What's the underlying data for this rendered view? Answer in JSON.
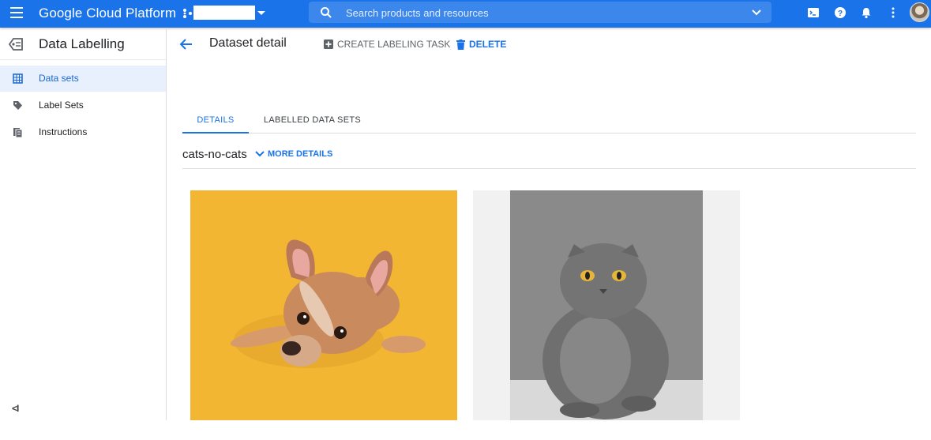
{
  "topbar": {
    "brand": "Google Cloud Platform",
    "search_placeholder": "Search products and resources",
    "icons": [
      "menu-icon",
      "project-icon",
      "search-icon",
      "chevron-down-icon",
      "cloud-shell-icon",
      "help-icon",
      "notifications-icon",
      "more-vert-icon"
    ],
    "accent": "#1a73e8"
  },
  "sidebar": {
    "title": "Data Labelling",
    "items": [
      {
        "label": "Data sets",
        "icon": "dataset-icon",
        "active": true
      },
      {
        "label": "Label Sets",
        "icon": "label-icon",
        "active": false
      },
      {
        "label": "Instructions",
        "icon": "instructions-icon",
        "active": false
      }
    ],
    "collapse_label": "<I"
  },
  "main": {
    "title": "Dataset detail",
    "actions": {
      "create": "CREATE LABELING TASK",
      "delete": "DELETE"
    },
    "tabs": [
      "DETAILS",
      "LABELLED DATA SETS"
    ],
    "dataset_name": "cats-no-cats",
    "more_details": "MORE DETAILS",
    "images": [
      {
        "subject": "dog",
        "background": "#f2b632"
      },
      {
        "subject": "cat",
        "background": "#f1f1f1"
      }
    ]
  }
}
